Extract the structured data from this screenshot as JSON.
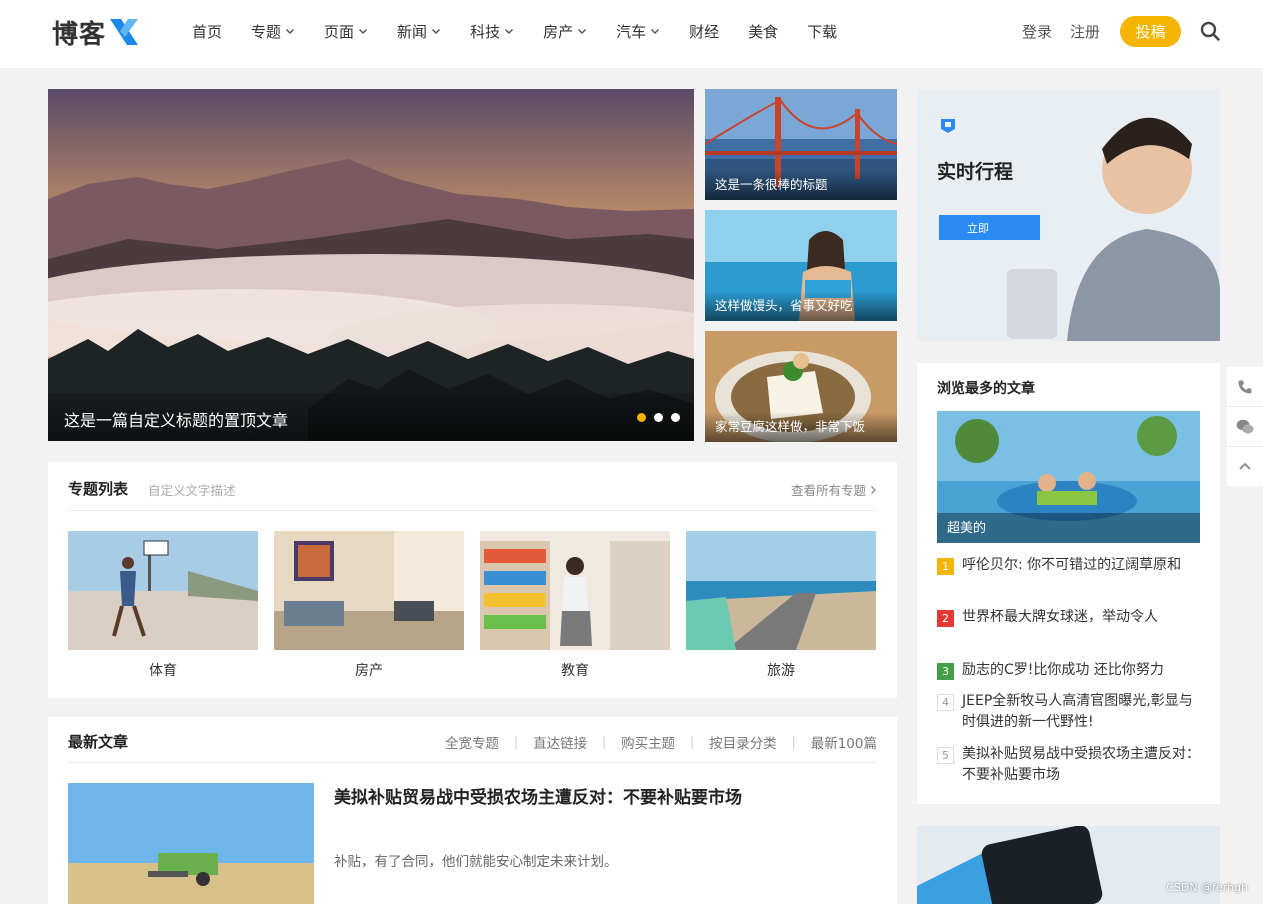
{
  "header": {
    "logo_text": "博客",
    "nav": [
      {
        "label": "首页",
        "dropdown": false
      },
      {
        "label": "专题",
        "dropdown": true
      },
      {
        "label": "页面",
        "dropdown": true
      },
      {
        "label": "新闻",
        "dropdown": true
      },
      {
        "label": "科技",
        "dropdown": true
      },
      {
        "label": "房产",
        "dropdown": true
      },
      {
        "label": "汽车",
        "dropdown": true
      },
      {
        "label": "财经",
        "dropdown": false
      },
      {
        "label": "美食",
        "dropdown": false
      },
      {
        "label": "下载",
        "dropdown": false
      }
    ],
    "login": "登录",
    "register": "注册",
    "post_button": "投稿",
    "accent_color": "#f5b400",
    "logo_x_color": "#1e88e5"
  },
  "hero": {
    "main_caption": "这是一篇自定义标题的置顶文章",
    "side": [
      {
        "caption": "这是一条很棒的标题"
      },
      {
        "caption": "这样做馒头，省事又好吃"
      },
      {
        "caption": "家常豆腐这样做，非常下饭"
      }
    ]
  },
  "ad": {
    "title": "实时行程",
    "button": "立即"
  },
  "topics": {
    "title": "专题列表",
    "desc": "自定义文字描述",
    "more": "查看所有专题",
    "items": [
      {
        "label": "体育"
      },
      {
        "label": "房产"
      },
      {
        "label": "教育"
      },
      {
        "label": "旅游"
      }
    ]
  },
  "latest": {
    "title": "最新文章",
    "tabs": [
      "全宽专题",
      "直达链接",
      "购买主题",
      "按目录分类",
      "最新100篇"
    ],
    "article": {
      "title": "美拟补贴贸易战中受损农场主遭反对：不要补贴要市场",
      "excerpt": "补贴，有了合同，他们就能安心制定未来计划。"
    }
  },
  "ranking": {
    "title": "浏览最多的文章",
    "feature_caption": "超美的",
    "items": [
      {
        "num": "1",
        "text": "呼伦贝尔: 你不可错过的辽阔草原和",
        "color": "#f5b400"
      },
      {
        "num": "2",
        "text": "世界杯最大牌女球迷，举动令人",
        "color": "#e53935"
      },
      {
        "num": "3",
        "text": "励志的C罗!比你成功 还比你努力",
        "color": "#43a047"
      },
      {
        "num": "4",
        "text": "JEEP全新牧马人高清官图曝光,彰显与时俱进的新一代野性!",
        "color": ""
      },
      {
        "num": "5",
        "text": "美拟补贴贸易战中受损农场主遭反对：不要补贴要市场",
        "color": ""
      }
    ]
  },
  "watermark": "CSDN @ferhgh"
}
